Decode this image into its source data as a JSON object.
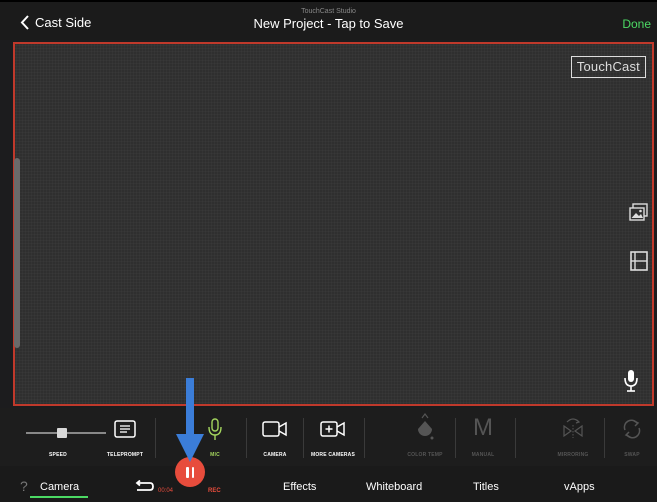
{
  "topbar": {
    "back_label": "Cast Side",
    "app_name": "TouchCast Studio",
    "project_title": "New Project - Tap to Save",
    "done_label": "Done"
  },
  "stage": {
    "logo_text": "TouchCast",
    "right_icons": [
      "image-gallery-icon",
      "film-strip-icon"
    ],
    "mic_icon": "microphone-icon"
  },
  "controls": {
    "speed_label": "SPEED",
    "speed_level": 0.45,
    "teleprompt_label": "TELEPROMPT",
    "mic_label": "MIC",
    "camera_label": "CAMERA",
    "more_cameras_label": "MORE CAMERAS",
    "color_temp_label": "COLOR TEMP",
    "manual_label": "MANUAL",
    "manual_glyph": "M",
    "mirroring_label": "MIRRORING",
    "swap_label": "SWAP"
  },
  "tabbar": {
    "help_glyph": "?",
    "tabs": [
      "Camera",
      "Effects",
      "Whiteboard",
      "Titles",
      "vApps"
    ],
    "active_tab": "Camera",
    "timer": "00:04",
    "rec_label": "REC"
  },
  "colors": {
    "accent_green": "#4cd964",
    "record_red": "#e74c3c",
    "stage_border": "#c0392b",
    "annotation_blue": "#3b7dd8"
  }
}
